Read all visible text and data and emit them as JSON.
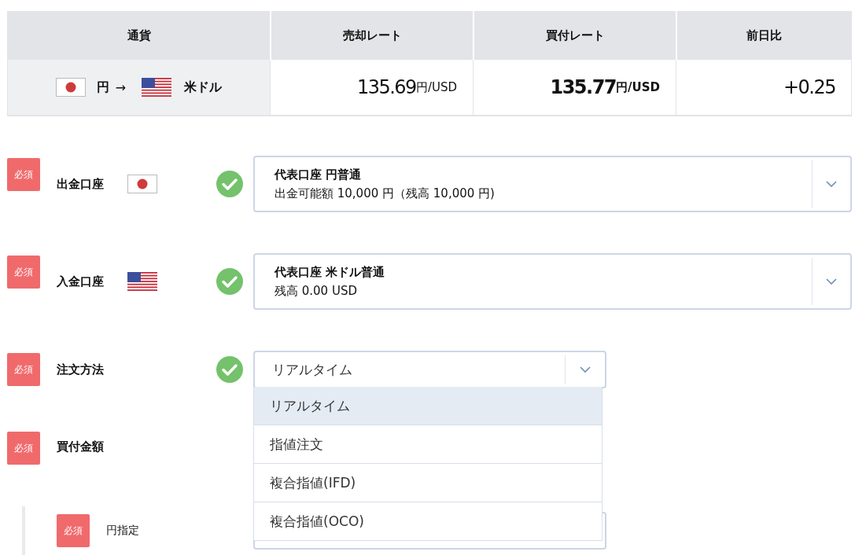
{
  "rate_table": {
    "columns": [
      "通貨",
      "売却レート",
      "買付レート",
      "前日比"
    ],
    "row": {
      "from_flag": {
        "kind": "jp"
      },
      "from_currency": "円",
      "arrow": "→",
      "to_flag": {
        "kind": "us"
      },
      "to_currency": "米ドル",
      "sell_rate": "135.69",
      "sell_unit": "円/USD",
      "buy_rate": "135.77",
      "buy_unit": "円/USD",
      "change": "+0.25"
    }
  },
  "form": {
    "fields": [
      {
        "kind": "account",
        "badge": "必須",
        "label": "出金口座",
        "flag": {
          "kind": "jp"
        },
        "valid": true,
        "title": "代表口座 円普通",
        "detail": "出金可能額 10,000 円（残高 10,000 円)"
      },
      {
        "kind": "account",
        "badge": "必須",
        "label": "入金口座",
        "flag": {
          "kind": "us"
        },
        "valid": true,
        "title": "代表口座 米ドル普通",
        "detail": "残高 0.00 USD"
      },
      {
        "kind": "select",
        "badge": "必須",
        "label": "注文方法",
        "valid": true,
        "value": "リアルタイム",
        "expanded": true,
        "options": [
          {
            "label": "リアルタイム",
            "selected": true
          },
          {
            "label": "指値注文",
            "selected": false
          },
          {
            "label": "複合指値(IFD)",
            "selected": false
          },
          {
            "label": "複合指値(OCO)",
            "selected": false
          }
        ]
      },
      {
        "kind": "heading",
        "badge": "必須",
        "label": "買付金額",
        "valid": false
      },
      {
        "kind": "sub",
        "badge": "必須",
        "label": "円指定",
        "valid": false
      }
    ]
  }
}
